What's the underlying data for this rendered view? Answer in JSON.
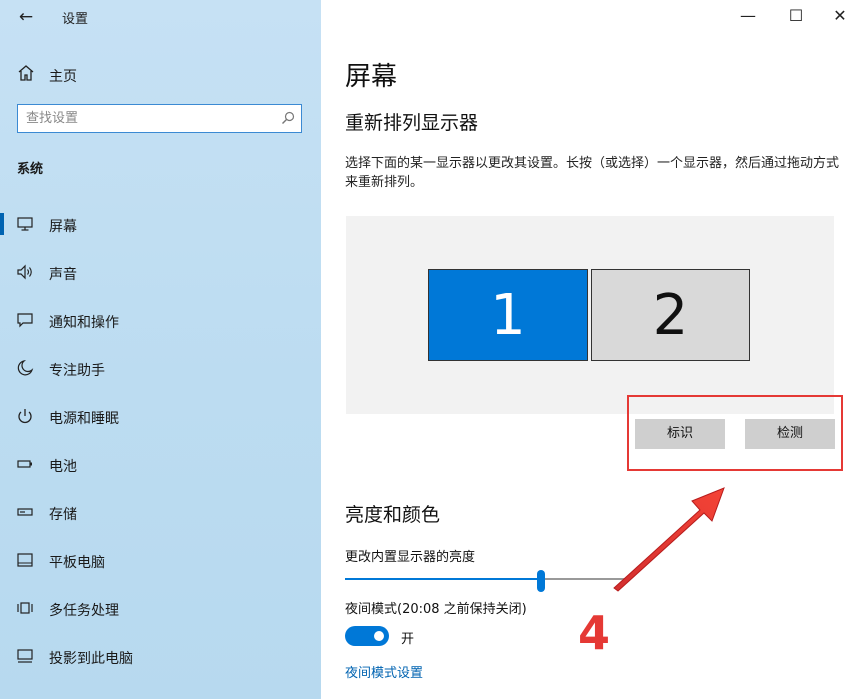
{
  "window": {
    "title": "设置",
    "back_icon": "←",
    "controls": {
      "minimize": "—",
      "maximize": "☐",
      "close": "✕"
    }
  },
  "sidebar": {
    "home_label": "主页",
    "search_placeholder": "查找设置",
    "section": "系统",
    "items": [
      {
        "label": "屏幕",
        "icon": "monitor-icon",
        "active": true
      },
      {
        "label": "声音",
        "icon": "speaker-icon"
      },
      {
        "label": "通知和操作",
        "icon": "notification-icon"
      },
      {
        "label": "专注助手",
        "icon": "moon-icon"
      },
      {
        "label": "电源和睡眠",
        "icon": "power-icon"
      },
      {
        "label": "电池",
        "icon": "battery-icon"
      },
      {
        "label": "存储",
        "icon": "storage-icon"
      },
      {
        "label": "平板电脑",
        "icon": "tablet-icon"
      },
      {
        "label": "多任务处理",
        "icon": "multitask-icon"
      },
      {
        "label": "投影到此电脑",
        "icon": "project-icon"
      }
    ]
  },
  "main": {
    "title": "屏幕",
    "arrange_title": "重新排列显示器",
    "arrange_desc": "选择下面的某一显示器以更改其设置。长按（或选择）一个显示器，然后通过拖动方式来重新排列。",
    "monitors": [
      {
        "label": "1",
        "selected": true
      },
      {
        "label": "2",
        "selected": false
      }
    ],
    "identify_button": "标识",
    "detect_button": "检测",
    "brightness_title": "亮度和颜色",
    "brightness_label": "更改内置显示器的亮度",
    "brightness_level": 0.7,
    "night_light_label": "夜间模式(20:08 之前保持关闭)",
    "night_light_state": "开",
    "night_light_link": "夜间模式设置"
  },
  "annotation": {
    "number": "4",
    "color": "#e53935"
  },
  "colors": {
    "accent": "#0078d7",
    "sidebar_bg": "#bcdcf1",
    "highlight": "#e53935"
  }
}
